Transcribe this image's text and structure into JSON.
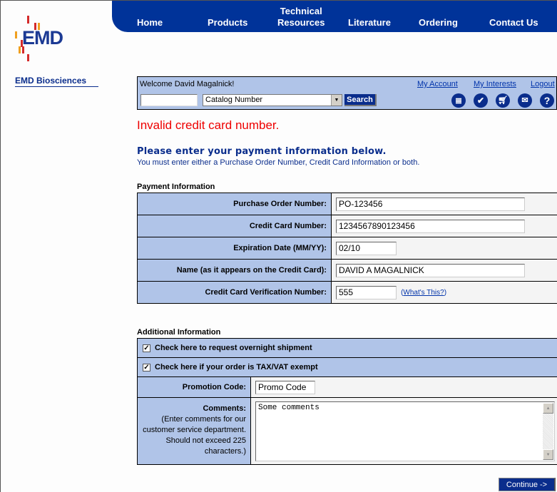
{
  "brand": {
    "logo_text": "EMD",
    "sidebar_title": "EMD Biosciences",
    "colors": {
      "primary": "#003399",
      "panel": "#b0c4e8",
      "error": "#ee0000",
      "logo_red": "#d42b2b",
      "logo_orange": "#f0a020"
    }
  },
  "nav": {
    "items": [
      {
        "label": "Home"
      },
      {
        "label": "Products"
      },
      {
        "label": "Technical Resources",
        "line1": "Technical",
        "line2": "Resources"
      },
      {
        "label": "Literature"
      },
      {
        "label": "Ordering"
      },
      {
        "label": "Contact Us"
      }
    ]
  },
  "account_bar": {
    "welcome": "Welcome David Magalnick!",
    "links": {
      "my_account": "My Account",
      "my_interests": "My Interests",
      "logout": "Logout"
    },
    "search": {
      "value": "",
      "select_value": "Catalog Number",
      "button": "Search"
    },
    "icons": [
      "document-list-icon",
      "checkmark-icon",
      "shopping-cart-icon",
      "envelope-icon",
      "help-icon"
    ]
  },
  "messages": {
    "error": "Invalid credit card number.",
    "title": "Please enter your payment information below.",
    "subtitle": "You must enter either a Purchase Order Number, Credit Card Information or both."
  },
  "payment": {
    "section_label": "Payment Information",
    "fields": [
      {
        "label": "Purchase Order Number:",
        "value": "PO-123456"
      },
      {
        "label": "Credit Card Number:",
        "value": "1234567890123456"
      },
      {
        "label": "Expiration Date (MM/YY):",
        "value": "02/10"
      },
      {
        "label": "Name (as it appears on the Credit Card):",
        "value": "DAVID A MAGALNICK"
      },
      {
        "label": "Credit Card Verification Number:",
        "value": "555",
        "help_link": "What's This?"
      }
    ]
  },
  "additional": {
    "section_label": "Additional Information",
    "overnight": {
      "label": "Check here to request overnight shipment",
      "checked": true
    },
    "tax_exempt": {
      "label": "Check here if your order is TAX/VAT exempt",
      "checked": true
    },
    "promo": {
      "label": "Promotion Code:",
      "value": "Promo Code"
    },
    "comments": {
      "label": "Comments:",
      "help": "(Enter comments for our customer service department. Should not exceed 225 characters.)",
      "value": "Some comments"
    }
  },
  "actions": {
    "continue": "Continue ->"
  }
}
